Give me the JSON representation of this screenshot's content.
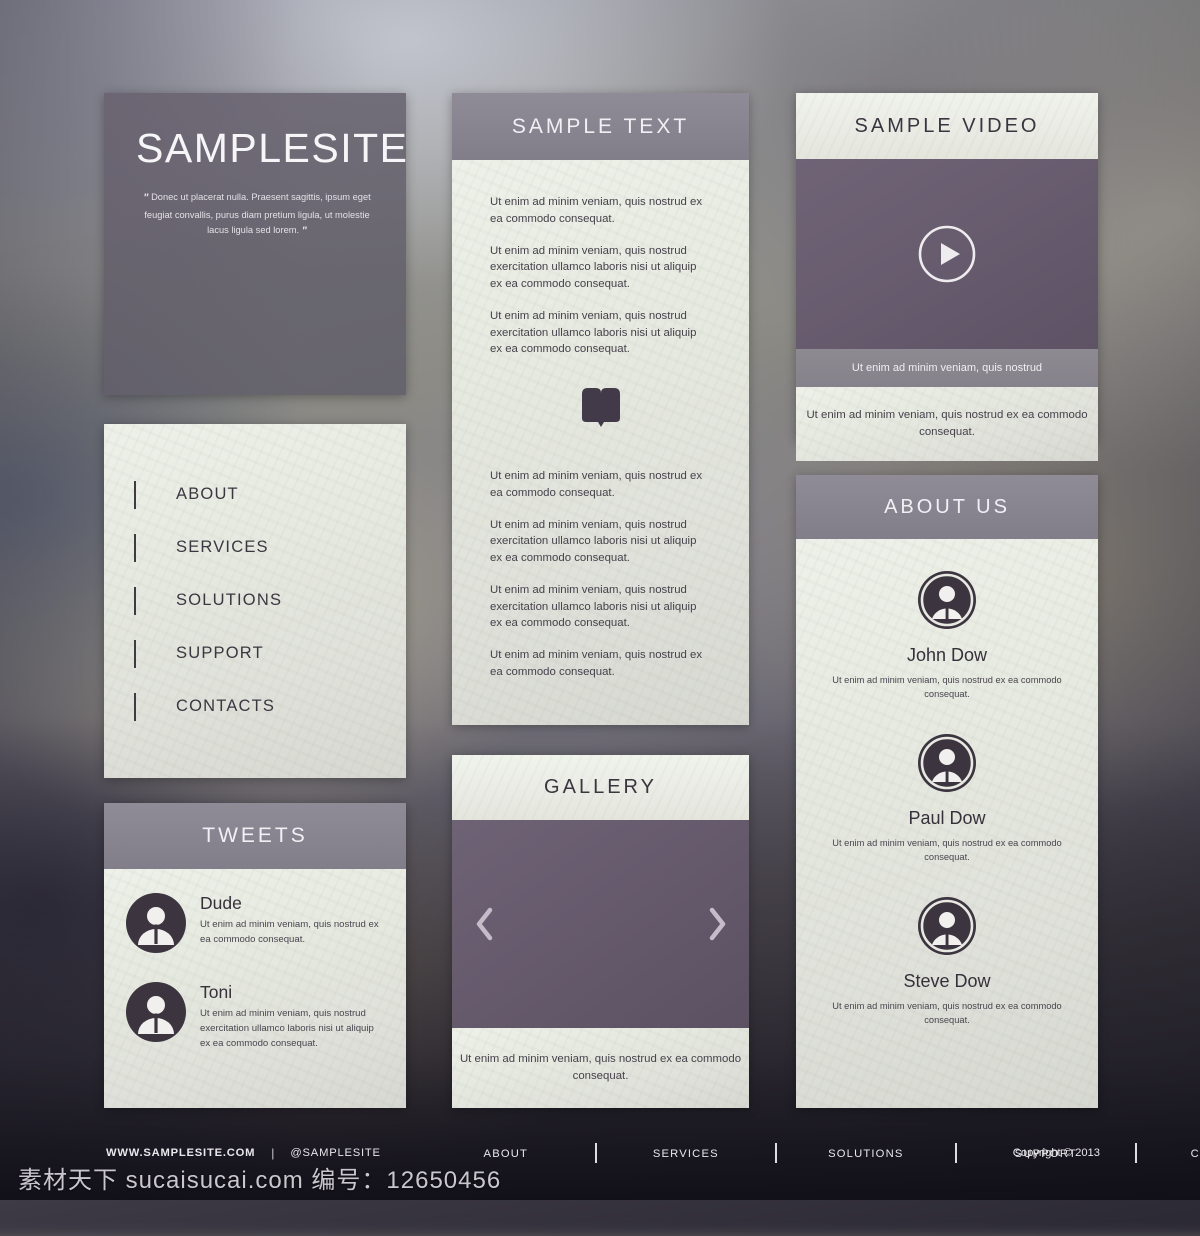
{
  "hero": {
    "title": "SAMPLESITE",
    "quote": "Donec ut placerat nulla. Praesent sagittis, ipsum eget feugiat convallis, purus diam pretium ligula, ut molestie lacus ligula sed lorem.",
    "quote_open": "\"",
    "quote_close": "\""
  },
  "nav": {
    "items": [
      {
        "label": "ABOUT"
      },
      {
        "label": "SERVICES"
      },
      {
        "label": "SOLUTIONS"
      },
      {
        "label": "SUPPORT"
      },
      {
        "label": "CONTACTS"
      }
    ]
  },
  "tweets": {
    "heading": "TWEETS",
    "items": [
      {
        "name": "Dude",
        "text": "Ut enim ad minim veniam, quis nostrud ex ea commodo consequat."
      },
      {
        "name": "Toni",
        "text": "Ut enim ad minim veniam, quis nostrud exercitation ullamco laboris nisi ut aliquip ex ea commodo consequat."
      }
    ]
  },
  "sample_text": {
    "heading": "SAMPLE TEXT",
    "paragraphs_top": [
      "Ut enim ad minim veniam, quis nostrud ex ea commodo consequat.",
      "Ut enim ad minim veniam, quis nostrud exercitation ullamco laboris nisi ut aliquip ex ea commodo consequat.",
      "Ut enim ad minim veniam, quis nostrud exercitation ullamco laboris nisi ut aliquip ex ea commodo consequat."
    ],
    "icon": "book-icon",
    "paragraphs_bottom": [
      "Ut enim ad minim veniam, quis nostrud ex ea commodo consequat.",
      "Ut enim ad minim veniam, quis nostrud exercitation ullamco laboris nisi ut aliquip ex ea commodo consequat.",
      "Ut enim ad minim veniam, quis nostrud exercitation ullamco laboris nisi ut aliquip ex ea commodo consequat.",
      "Ut enim ad minim veniam, quis nostrud ex ea commodo consequat."
    ]
  },
  "gallery": {
    "heading": "GALLERY",
    "prev_icon": "chevron-left-icon",
    "next_icon": "chevron-right-icon",
    "caption": "Ut enim ad minim veniam, quis nostrud ex ea commodo consequat."
  },
  "video": {
    "heading": "SAMPLE VIDEO",
    "play_icon": "play-icon",
    "caption": "Ut enim ad minim veniam, quis nostrud",
    "description": "Ut enim ad minim veniam, quis nostrud ex ea commodo consequat."
  },
  "about": {
    "heading": "ABOUT US",
    "members": [
      {
        "name": "John Dow",
        "text": "Ut enim ad minim veniam, quis nostrud ex ea commodo consequat."
      },
      {
        "name": "Paul Dow",
        "text": "Ut enim ad minim veniam, quis nostrud ex ea commodo consequat."
      },
      {
        "name": "Steve Dow",
        "text": "Ut enim ad minim veniam, quis nostrud ex ea commodo consequat."
      }
    ]
  },
  "footer": {
    "site": "WWW.SAMPLESITE.COM",
    "separator": "|",
    "handle": "@SAMPLESITE",
    "links": [
      "ABOUT",
      "SERVICES",
      "SOLUTIONS",
      "SUPPORT",
      "CONTACTS"
    ],
    "copyright": "Copyright © 2013"
  },
  "watermark": {
    "text": "素材天下 sucaisucai.com  编号：12650456"
  },
  "colors": {
    "header_bar": "#857f8c",
    "panel_body": "#e5e8e0",
    "accent_purple": "#685c6f",
    "dark_ink": "#3b3540"
  }
}
